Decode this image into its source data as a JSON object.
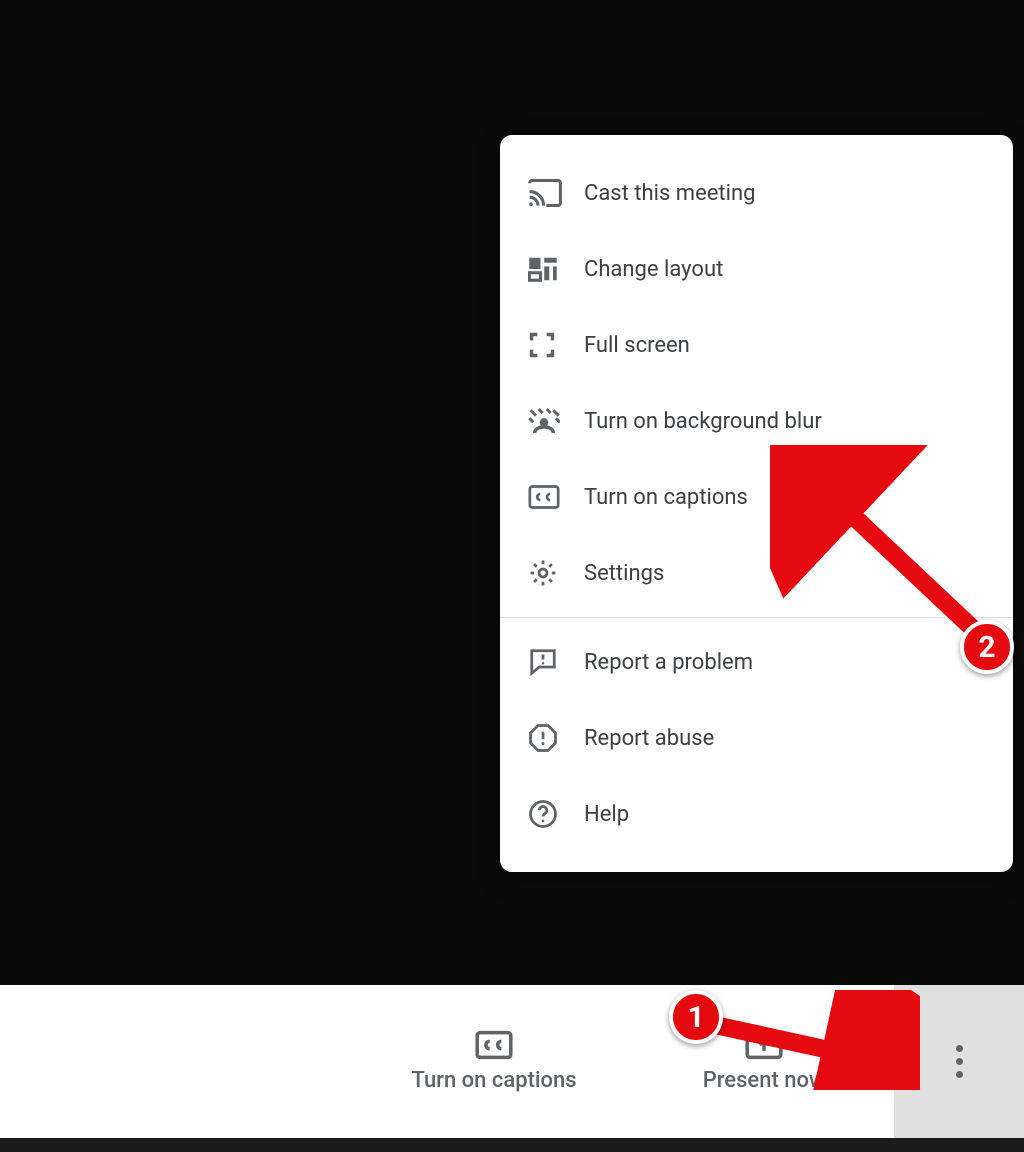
{
  "menu": {
    "items": [
      {
        "label": "Cast this meeting"
      },
      {
        "label": "Change layout"
      },
      {
        "label": "Full screen"
      },
      {
        "label": "Turn on background blur"
      },
      {
        "label": "Turn on captions"
      },
      {
        "label": "Settings"
      },
      {
        "label": "Report a problem"
      },
      {
        "label": "Report abuse"
      },
      {
        "label": "Help"
      }
    ]
  },
  "toolbar": {
    "captions_label": "Turn on captions",
    "present_label": "Present now"
  },
  "annotations": {
    "step1": "1",
    "step2": "2"
  }
}
